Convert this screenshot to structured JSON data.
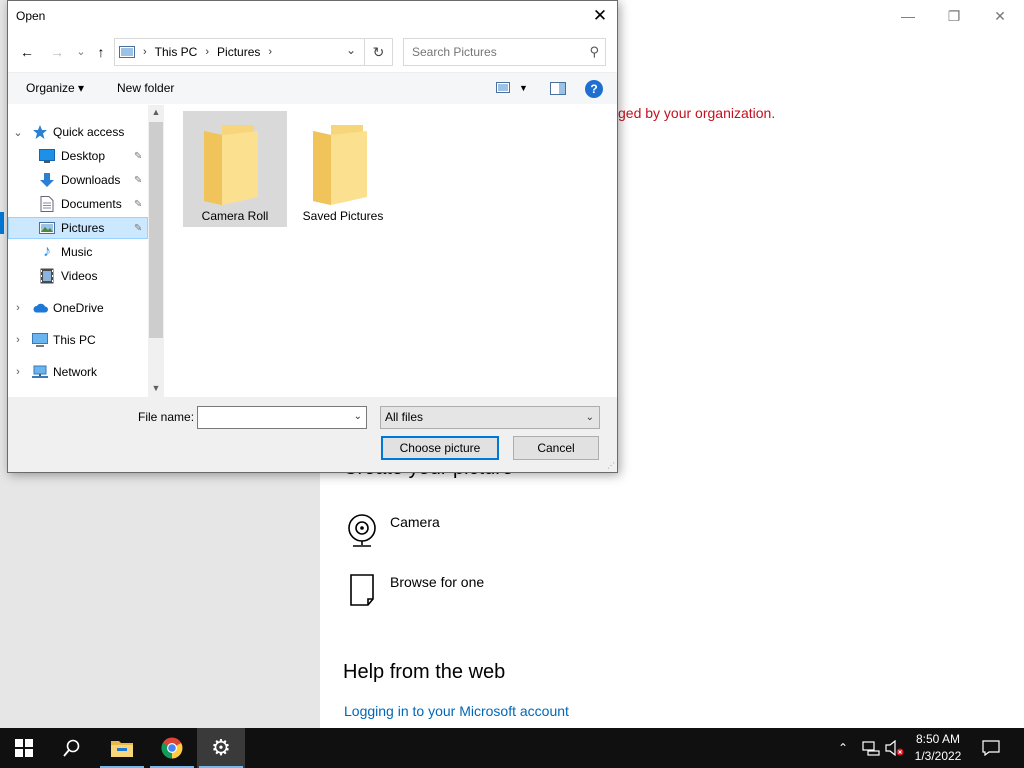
{
  "settings_window": {
    "org_message": "ged by your organization.",
    "create_heading": "Create your picture",
    "options": [
      {
        "label": "Camera",
        "icon": "camera-icon"
      },
      {
        "label": "Browse for one",
        "icon": "file-icon"
      }
    ],
    "help_heading": "Help from the web",
    "help_link": "Logging in to your Microsoft account",
    "controls": {
      "minimize": "—",
      "restore": "❐",
      "close": "✕"
    }
  },
  "dialog": {
    "title": "Open",
    "close_glyph": "✕",
    "nav": {
      "back": "←",
      "forward": "→",
      "recent": "⌄",
      "up": "↑",
      "refresh": "↻"
    },
    "address": {
      "crumbs": [
        "This PC",
        "Pictures"
      ],
      "separator": "›",
      "dropdown": "⌄"
    },
    "search": {
      "placeholder": "Search Pictures"
    },
    "toolbar": {
      "organize": "Organize ▾",
      "new_folder": "New folder",
      "help": "?"
    },
    "nav_pane": {
      "items": [
        {
          "label": "Quick access",
          "icon": "star-icon",
          "expanded": true
        },
        {
          "label": "Desktop",
          "icon": "desktop-icon",
          "pinned": true
        },
        {
          "label": "Downloads",
          "icon": "download-icon",
          "pinned": true
        },
        {
          "label": "Documents",
          "icon": "document-icon",
          "pinned": true
        },
        {
          "label": "Pictures",
          "icon": "pictures-icon",
          "pinned": true,
          "selected": true
        },
        {
          "label": "Music",
          "icon": "music-icon"
        },
        {
          "label": "Videos",
          "icon": "video-icon"
        },
        {
          "label": "OneDrive",
          "icon": "cloud-icon"
        },
        {
          "label": "This PC",
          "icon": "computer-icon"
        },
        {
          "label": "Network",
          "icon": "network-icon"
        }
      ],
      "pin_glyph": "📌",
      "expanded_chevron": "⌄",
      "collapsed_chevron": "›"
    },
    "files": [
      {
        "name": "Camera Roll",
        "selected": true
      },
      {
        "name": "Saved Pictures",
        "selected": false
      }
    ],
    "filename_label": "File name:",
    "filename_value": "",
    "filter_selected": "All files",
    "choose_button": "Choose picture",
    "cancel_button": "Cancel"
  },
  "taskbar": {
    "time": "8:50 AM",
    "date": "1/3/2022",
    "accent": "#76b9ed"
  },
  "colors": {
    "accent": "#0078d7",
    "error_text": "#c50f1f",
    "link": "#0067b8",
    "selection": "#cce8ff"
  }
}
